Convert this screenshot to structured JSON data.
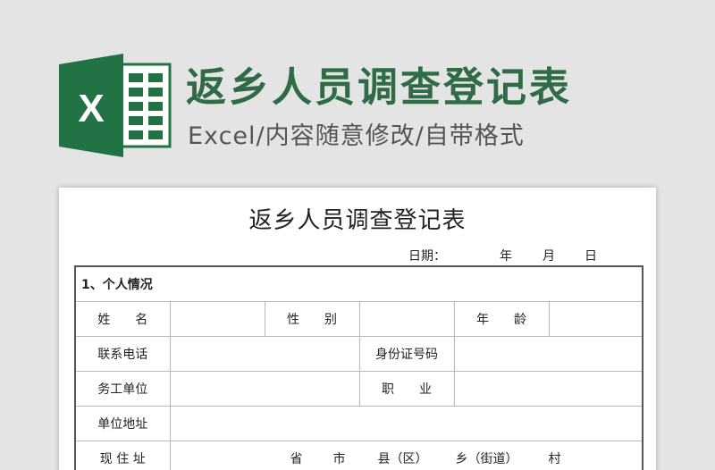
{
  "banner": {
    "logo_letter": "X",
    "title": "返乡人员调查登记表",
    "subtitle": "Excel/内容随意修改/自带格式",
    "brand_color": "#217346",
    "title_color": "#2f6b45"
  },
  "document": {
    "title": "返乡人员调查登记表",
    "date_label": "日期：",
    "date_year": "年",
    "date_month": "月",
    "date_day": "日",
    "section_1": "1、个人情况",
    "labels": {
      "name": "姓　　名",
      "gender": "性　　别",
      "age": "年　　龄",
      "phone": "联系电话",
      "id_number": "身份证号码",
      "work_unit": "务工单位",
      "occupation": "职　　业",
      "unit_address": "单位地址",
      "current_address": "现 住 址"
    },
    "address_parts": {
      "province": "省",
      "city": "市",
      "county": "县（区）",
      "township": "乡（街道）",
      "village": "村"
    }
  }
}
